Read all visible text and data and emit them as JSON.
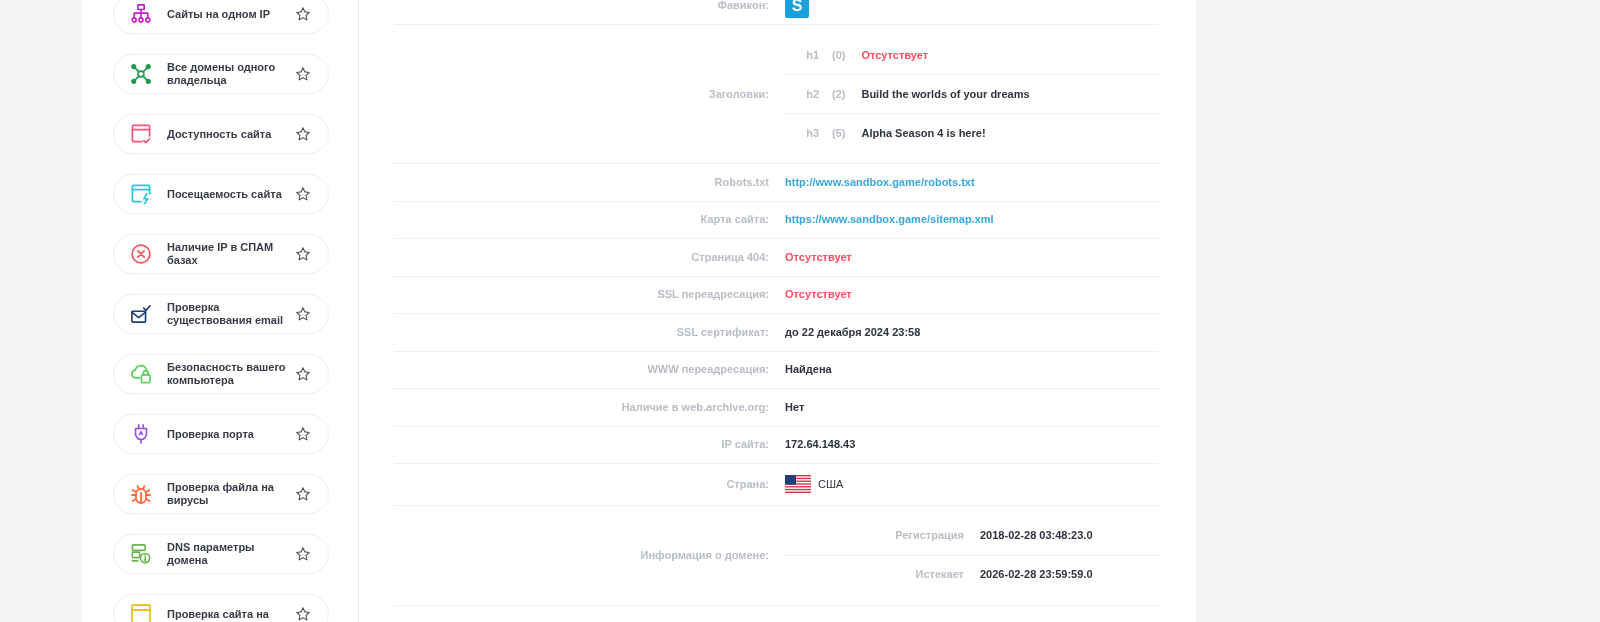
{
  "sidebar": {
    "items": [
      {
        "kind": "sitemap",
        "label": "Сайты на одном IP",
        "favorite": false
      },
      {
        "kind": "network",
        "label": "Все домены одного владельца",
        "favorite": false
      },
      {
        "kind": "browser-check",
        "label": "Доступность сайта",
        "favorite": false
      },
      {
        "kind": "browser-bolt",
        "label": "Посещаемость сайта",
        "favorite": false
      },
      {
        "kind": "x-circle",
        "label": "Наличие IP в СПАМ базах",
        "favorite": false
      },
      {
        "kind": "mail-check",
        "label": "Проверка существования email",
        "favorite": false
      },
      {
        "kind": "cloud-lock",
        "label": "Безопасность вашего компьютера",
        "favorite": false
      },
      {
        "kind": "plug",
        "label": "Проверка порта",
        "favorite": false
      },
      {
        "kind": "bug",
        "label": "Проверка файла на вирусы",
        "favorite": false
      },
      {
        "kind": "server-info",
        "label": "DNS параметры домена",
        "favorite": false
      },
      {
        "kind": "browser",
        "label": "Проверка сайта на",
        "favorite": false
      }
    ]
  },
  "report": {
    "rows": [
      {
        "kind": "favicon",
        "label": "Фавикон:",
        "logo": "S"
      },
      {
        "kind": "headings",
        "label": "Заголовки:",
        "items": [
          {
            "tag": "h1",
            "count": "(0)",
            "text": "Отсутствует",
            "missing": true
          },
          {
            "tag": "h2",
            "count": "(2)",
            "text": "Build the worlds of your dreams",
            "missing": false
          },
          {
            "tag": "h3",
            "count": "(5)",
            "text": "Alpha Season 4 is here!",
            "missing": false
          }
        ]
      },
      {
        "kind": "link",
        "label": "Robots.txt",
        "value": "http://www.sandbox.game/robots.txt"
      },
      {
        "kind": "link",
        "label": "Карта сайта:",
        "value": "https://www.sandbox.game/sitemap.xml"
      },
      {
        "kind": "text",
        "label": "Страница 404:",
        "value": "Отсутствует",
        "missing": true
      },
      {
        "kind": "text",
        "label": "SSL переадресация:",
        "value": "Отсутствует",
        "missing": true
      },
      {
        "kind": "text",
        "label": "SSL сертификат:",
        "value": "до 22 декабря 2024 23:58",
        "missing": false
      },
      {
        "kind": "text",
        "label": "WWW переадресация:",
        "value": "Найдена",
        "missing": false
      },
      {
        "kind": "text",
        "label": "Наличие в web.archive.org:",
        "value": "Нет",
        "missing": false
      },
      {
        "kind": "text",
        "label": "IP сайта:",
        "value": "172.64.148.43",
        "missing": false
      },
      {
        "kind": "country",
        "label": "Страна:",
        "value": "США"
      },
      {
        "kind": "dates",
        "label": "Информация о домене:",
        "items": [
          {
            "label": "Регистрация",
            "value": "2018-02-28 03:48:23.0"
          },
          {
            "label": "Истекает",
            "value": "2026-02-28 23:59:59.0"
          }
        ]
      }
    ]
  }
}
